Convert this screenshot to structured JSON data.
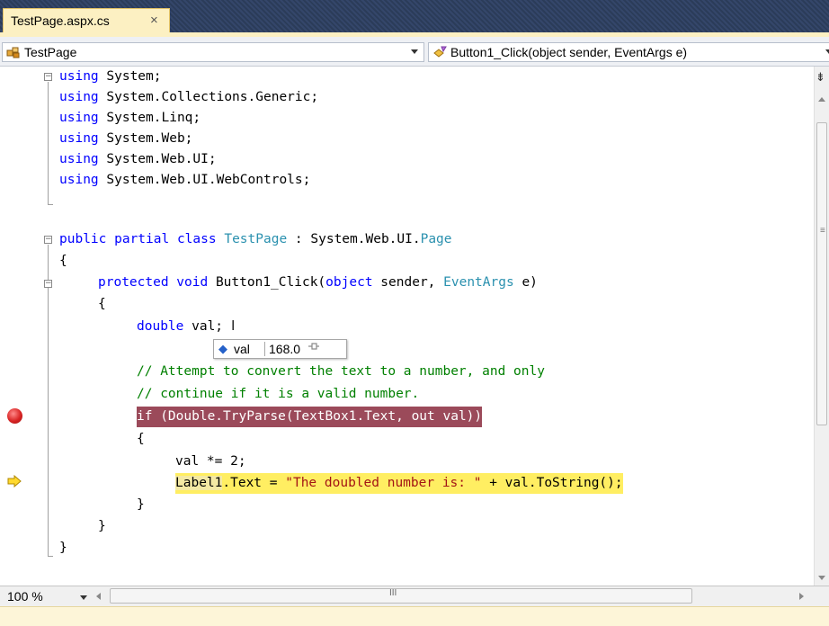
{
  "tab": {
    "label": "TestPage.aspx.cs",
    "close_icon": "×"
  },
  "navbar": {
    "class_combo": "TestPage",
    "member_combo": "Button1_Click(object sender, EventArgs e)"
  },
  "code": {
    "l1_kw": "using",
    "l1_rest": " System;",
    "l2_kw": "using",
    "l2_rest": " System.Collections.Generic;",
    "l3_kw": "using",
    "l3_rest": " System.Linq;",
    "l4_kw": "using",
    "l4_rest": " System.Web;",
    "l5_kw": "using",
    "l5_rest": " System.Web.UI;",
    "l6_kw": "using",
    "l6_rest": " System.Web.UI.WebControls;",
    "l8_kw": "public partial class",
    "l8_sp": " ",
    "l8_type": "TestPage",
    "l8_mid": " : System.Web.UI.",
    "l8_type2": "Page",
    "l9": "{",
    "l10_kw": "protected void",
    "l10_mid": " Button1_Click(",
    "l10_kw2": "object",
    "l10_mid2": " sender, ",
    "l10_type": "EventArgs",
    "l10_end": " e)",
    "l11": "{",
    "l12_kw": "double",
    "l12_rest": " val;",
    "l14": "// Attempt to convert the text to a number, and only",
    "l15": "// continue if it is a valid number.",
    "l16_kw": "if",
    "l16_rest": " (Double.TryParse(TextBox1.Text, ",
    "l16_kw2": "out",
    "l16_end": " val))",
    "l17": "{",
    "l18": "val *= 2;",
    "l19_lbl": "Label1",
    "l19_mid": ".Text = ",
    "l19_str": "\"The doubled number is: \"",
    "l19_end": " + val.ToString();",
    "l20": "}",
    "l21": "}",
    "l22": "}"
  },
  "datatip": {
    "name": "val",
    "value": "168.0"
  },
  "status": {
    "zoom": "100 %"
  },
  "colors": {
    "keyword": "#0000ff",
    "type": "#2b91af",
    "comment": "#008000",
    "string": "#a31515",
    "breakpoint_line": "#9b4a5a",
    "current_line": "#ffee62"
  }
}
